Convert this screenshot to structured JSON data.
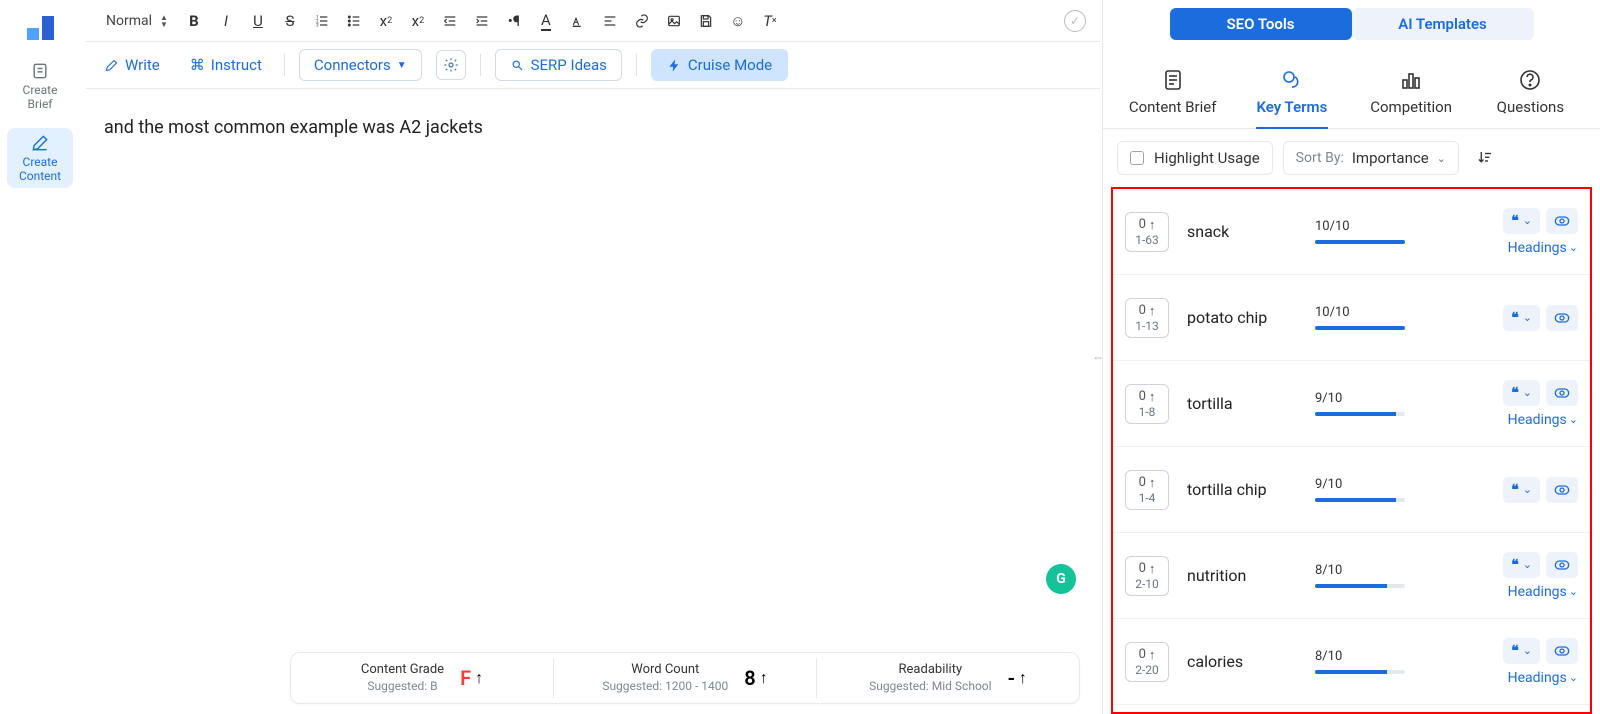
{
  "leftrail": {
    "create_brief": "Create\nBrief",
    "create_content": "Create\nContent"
  },
  "toolbar": {
    "format": "Normal"
  },
  "actions": {
    "write": "Write",
    "instruct": "Instruct",
    "connectors": "Connectors",
    "serp": "SERP Ideas",
    "cruise": "Cruise Mode"
  },
  "editor": {
    "content": "and the most common example was A2 jackets"
  },
  "status": {
    "grade_label": "Content Grade",
    "grade_sugg": "Suggested: B",
    "grade_val": "F",
    "wc_label": "Word Count",
    "wc_sugg": "Suggested: 1200 - 1400",
    "wc_val": "8",
    "read_label": "Readability",
    "read_sugg": "Suggested: Mid School",
    "read_val": "-"
  },
  "rpanel": {
    "tab_seo": "SEO Tools",
    "tab_ai": "AI Templates",
    "sub_brief": "Content Brief",
    "sub_key": "Key Terms",
    "sub_comp": "Competition",
    "sub_q": "Questions",
    "highlight": "Highlight Usage",
    "sortby": "Sort By:",
    "sortval": "Importance",
    "headings_label": "Headings"
  },
  "terms": [
    {
      "count": "0",
      "range": "1-63",
      "name": "snack",
      "score": "10/10",
      "pct": 100,
      "headings": true
    },
    {
      "count": "0",
      "range": "1-13",
      "name": "potato chip",
      "score": "10/10",
      "pct": 100,
      "headings": false
    },
    {
      "count": "0",
      "range": "1-8",
      "name": "tortilla",
      "score": "9/10",
      "pct": 90,
      "headings": true
    },
    {
      "count": "0",
      "range": "1-4",
      "name": "tortilla chip",
      "score": "9/10",
      "pct": 90,
      "headings": false
    },
    {
      "count": "0",
      "range": "2-10",
      "name": "nutrition",
      "score": "8/10",
      "pct": 80,
      "headings": true
    },
    {
      "count": "0",
      "range": "2-20",
      "name": "calories",
      "score": "8/10",
      "pct": 80,
      "headings": true
    }
  ]
}
